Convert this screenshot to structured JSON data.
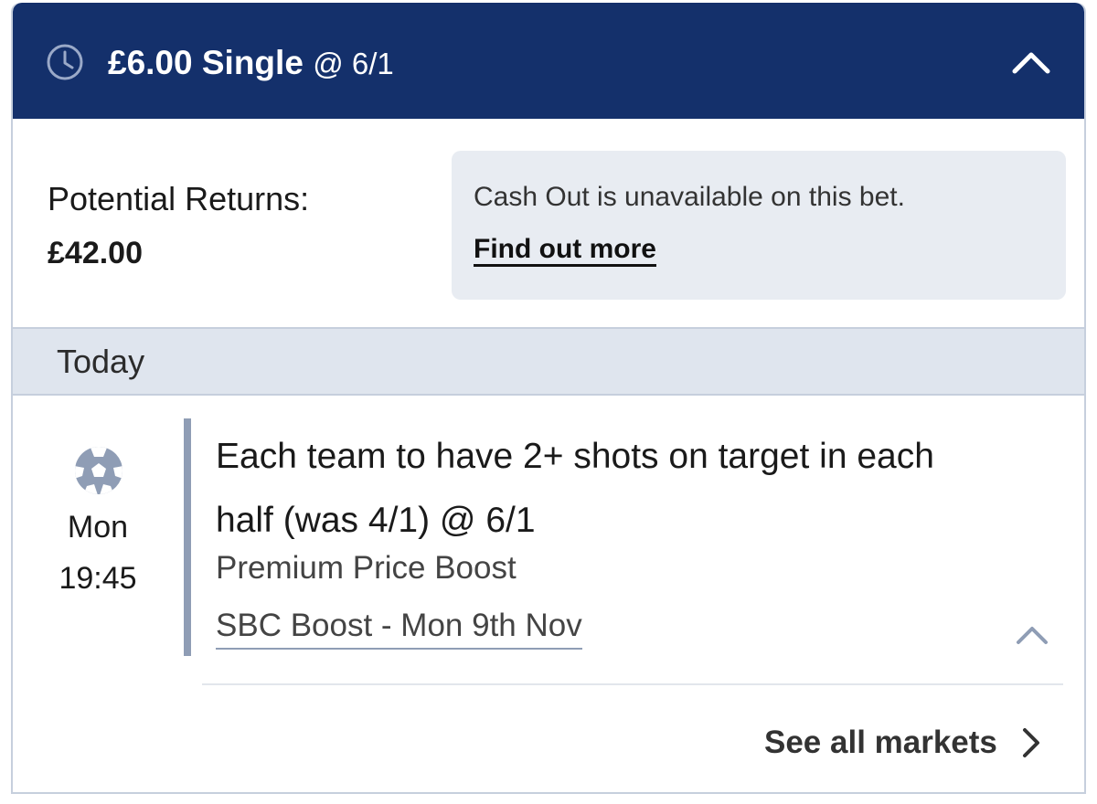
{
  "header": {
    "stake": "£6.00",
    "bet_type": "Single",
    "odds": "@ 6/1",
    "icon": "clock-icon",
    "collapse_icon": "chevron-up-icon"
  },
  "returns": {
    "label": "Potential Returns:",
    "value": "£42.00"
  },
  "cashout": {
    "message": "Cash Out is unavailable on this bet.",
    "link": "Find out more"
  },
  "day_header": "Today",
  "event": {
    "sport_icon": "football-icon",
    "day": "Mon",
    "time": "19:45",
    "selection": "Each team to have 2+ shots on target in each half (was 4/1) @ 6/1",
    "market": "Premium Price Boost",
    "event_name": "SBC Boost - Mon 9th Nov"
  },
  "footer": {
    "see_all": "See all markets"
  },
  "colors": {
    "header_bg": "#14306b",
    "panel_bg": "#e8ecf2",
    "day_bar_bg": "#dfe5ee",
    "accent_bar": "#8f9db5"
  }
}
